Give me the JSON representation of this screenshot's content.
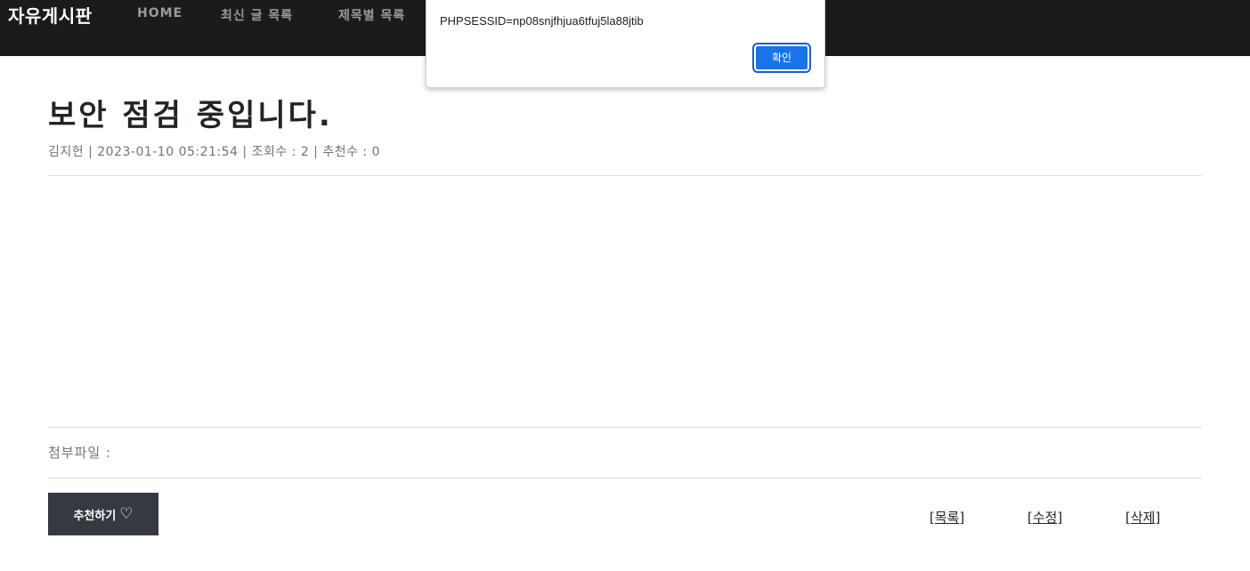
{
  "navbar": {
    "brand": "자유게시판",
    "links": [
      "HOME",
      "최신 글 목록",
      "제목별 목록"
    ]
  },
  "dialog": {
    "message": "PHPSESSID=np08snjfhjua6tfuj5la88jtib",
    "ok_label": "확인"
  },
  "post": {
    "title": "보안 점검 중입니다.",
    "meta": "김지헌 | 2023-01-10 05:21:54 | 조회수 : 2 | 추천수 : 0",
    "attachment_label": "첨부파일 :"
  },
  "actions": {
    "recommend_label": "추천하기",
    "heart_icon": "heart-outline-icon",
    "bracket_open": "[",
    "bracket_close": "]",
    "list_label": "목록",
    "edit_label": "수정",
    "delete_label": "삭제"
  },
  "colors": {
    "navbar_bg": "#1b1b1b",
    "dialog_button": "#1a73e8",
    "recommend_button": "#343a40"
  }
}
